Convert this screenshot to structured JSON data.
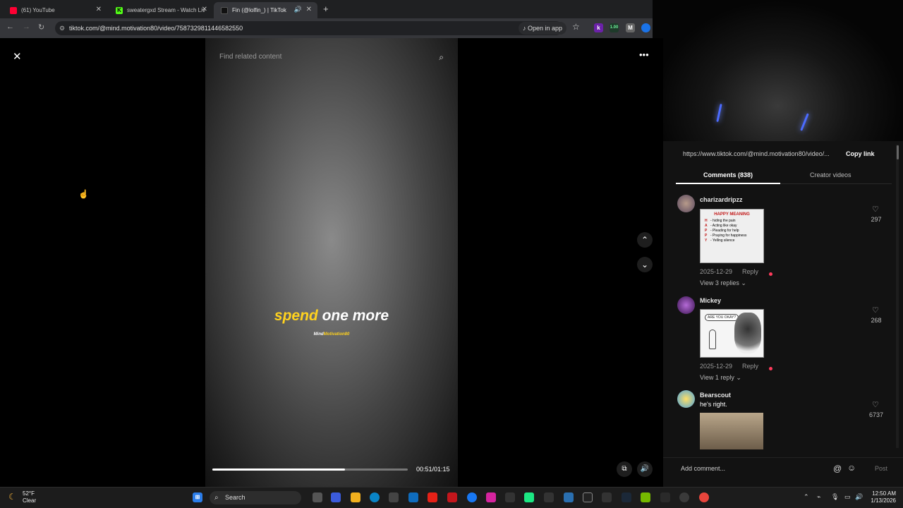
{
  "browser": {
    "tabs": [
      {
        "title": "(61) YouTube",
        "favicon_color": "#ff0033",
        "active": false
      },
      {
        "title": "sweatergxd Stream - Watch Liv",
        "favicon_color": "#53fc18",
        "active": false
      },
      {
        "title": "Fin (@lolfin_) | TikTok",
        "favicon_color": "#ffffff",
        "active": true
      }
    ],
    "new_tab": "+",
    "url": "tiktok.com/@mind.motivation80/video/7587329811446582550",
    "open_in_app": "Open in app",
    "ext_k": "k",
    "ext_num": "1.00",
    "ext_m": "M"
  },
  "video": {
    "search_placeholder": "Find related content",
    "caption_highlight": "spend",
    "caption_rest": " one more",
    "watermark_a": "Mind",
    "watermark_b": "Motivation80",
    "time": "00:51/01:15",
    "progress": 0.68
  },
  "panel": {
    "share_url": "https://www.tiktok.com/@mind.motivation80/video/...",
    "copy_link": "Copy link",
    "tab_comments": "Comments (838)",
    "tab_creator": "Creator videos",
    "comments": [
      {
        "user": "charizardripzz",
        "date": "2025-12-29",
        "reply": "Reply",
        "replies": "View 3 replies",
        "likes": "297"
      },
      {
        "user": "Mickey",
        "date": "2025-12-29",
        "reply": "Reply",
        "replies": "View 1 reply",
        "likes": "268"
      },
      {
        "user": "Bearscout",
        "text": "he's right.",
        "likes": "6737"
      }
    ],
    "happy_image": {
      "title": "HAPPY MEANING",
      "rows": [
        {
          "letter": "H",
          "text": "- hiding the pain"
        },
        {
          "letter": "A",
          "text": "- Acting like okay"
        },
        {
          "letter": "P",
          "text": "- Pleading for help"
        },
        {
          "letter": "P",
          "text": "- Praying for happiness"
        },
        {
          "letter": "Y",
          "text": "- Yelling silence"
        }
      ]
    },
    "mickey_image": {
      "bubble": "ARE YOU OKAY?"
    },
    "add_comment": "Add comment...",
    "post": "Post"
  },
  "taskbar": {
    "temp": "52°F",
    "condition": "Clear",
    "search": "Search",
    "time": "12:50 AM",
    "date": "1/13/2026"
  },
  "colors": {
    "accent_red": "#ff3b5c",
    "caption_yellow": "#ffd21e"
  }
}
